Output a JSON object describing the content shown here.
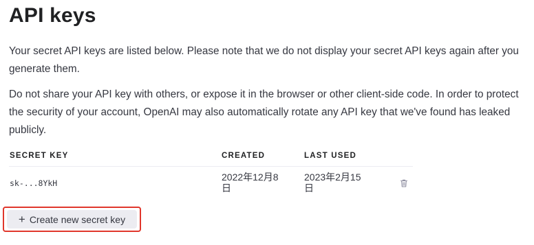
{
  "page": {
    "title": "API keys",
    "description_1": "Your secret API keys are listed below. Please note that we do not display your secret API keys again after you generate them.",
    "description_2": "Do not share your API key with others, or expose it in the browser or other client-side code. In order to protect the security of your account, OpenAI may also automatically rotate any API key that we've found has leaked publicly."
  },
  "table": {
    "headers": {
      "secret_key": "SECRET KEY",
      "created": "CREATED",
      "last_used": "LAST USED"
    },
    "rows": [
      {
        "secret_key": "sk-...8YkH",
        "created": "2022年12月8日",
        "last_used": "2023年2月15日",
        "delete_icon": "trash-icon"
      }
    ]
  },
  "actions": {
    "create_label": "Create new secret key",
    "create_icon": "plus-icon"
  },
  "colors": {
    "highlight": "#e0362b",
    "button_bg": "#ececf1"
  }
}
